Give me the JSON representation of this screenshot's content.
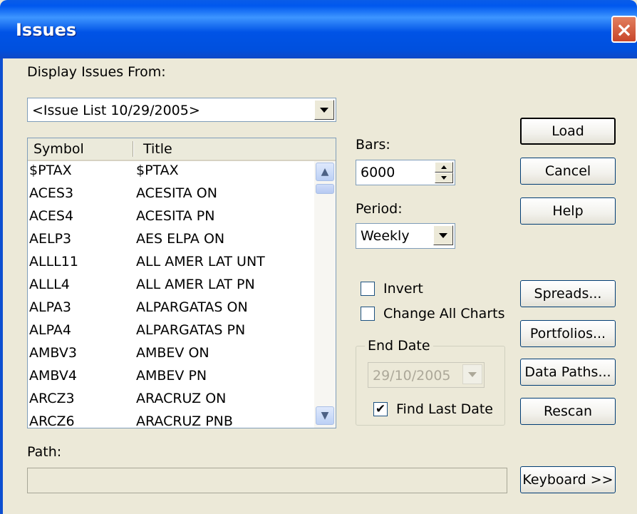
{
  "window": {
    "title": "Issues"
  },
  "display_from": {
    "label": "Display Issues From:",
    "selected": "<Issue List 10/29/2005>"
  },
  "issues_list": {
    "columns": [
      "Symbol",
      "Title"
    ],
    "rows": [
      {
        "symbol": "$PTAX",
        "title": "$PTAX"
      },
      {
        "symbol": "ACES3",
        "title": "ACESITA ON"
      },
      {
        "symbol": "ACES4",
        "title": "ACESITA PN"
      },
      {
        "symbol": "AELP3",
        "title": "AES ELPA ON"
      },
      {
        "symbol": "ALLL11",
        "title": "ALL AMER LAT UNT"
      },
      {
        "symbol": "ALLL4",
        "title": "ALL AMER LAT PN"
      },
      {
        "symbol": "ALPA3",
        "title": "ALPARGATAS ON"
      },
      {
        "symbol": "ALPA4",
        "title": "ALPARGATAS PN"
      },
      {
        "symbol": "AMBV3",
        "title": "AMBEV ON"
      },
      {
        "symbol": "AMBV4",
        "title": "AMBEV PN"
      },
      {
        "symbol": "ARCZ3",
        "title": "ARACRUZ ON"
      },
      {
        "symbol": "ARCZ6",
        "title": "ARACRUZ PNB"
      }
    ]
  },
  "bars": {
    "label": "Bars:",
    "value": "6000"
  },
  "period": {
    "label": "Period:",
    "selected": "Weekly"
  },
  "checkboxes": {
    "invert": {
      "label": "Invert",
      "checked": false
    },
    "change_all": {
      "label": "Change All Charts",
      "checked": false
    }
  },
  "end_date": {
    "label": "End Date",
    "value": "29/10/2005",
    "find_last": {
      "label": "Find Last Date",
      "checked": true,
      "mark": "✔"
    }
  },
  "buttons": {
    "load": "Load",
    "cancel": "Cancel",
    "help": "Help",
    "spreads": "Spreads...",
    "portfolios": "Portfolios...",
    "data_paths": "Data Paths...",
    "rescan": "Rescan",
    "keyboard": "Keyboard >>"
  },
  "path": {
    "label": "Path:",
    "value": ""
  },
  "icons": {
    "close": "×",
    "scroll_up": "▲",
    "scroll_down": "▼"
  },
  "colors": {
    "titlebar": "#0058ee",
    "dialog_bg": "#ece9d8",
    "close": "#c8462a"
  }
}
